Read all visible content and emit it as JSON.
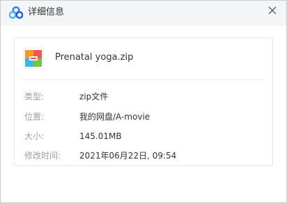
{
  "window": {
    "title": "详细信息",
    "close_icon": "close-icon",
    "logo_icon": "baidu-netdisk-logo-icon"
  },
  "file": {
    "name": "Prenatal yoga.zip",
    "icon": "zip-archive-icon"
  },
  "details": [
    {
      "label": "类型:",
      "value": "zip文件"
    },
    {
      "label": "位置:",
      "value": "我的网盘/A-movie"
    },
    {
      "label": "大小:",
      "value": "145.01MB"
    },
    {
      "label": "修改时间:",
      "value": "2021年06月22日, 09:54"
    }
  ],
  "colors": {
    "titlebar_bg": "#f4f5f7",
    "label_text": "#9aa0a8",
    "value_text": "#333333",
    "border": "#c9ccd1"
  }
}
